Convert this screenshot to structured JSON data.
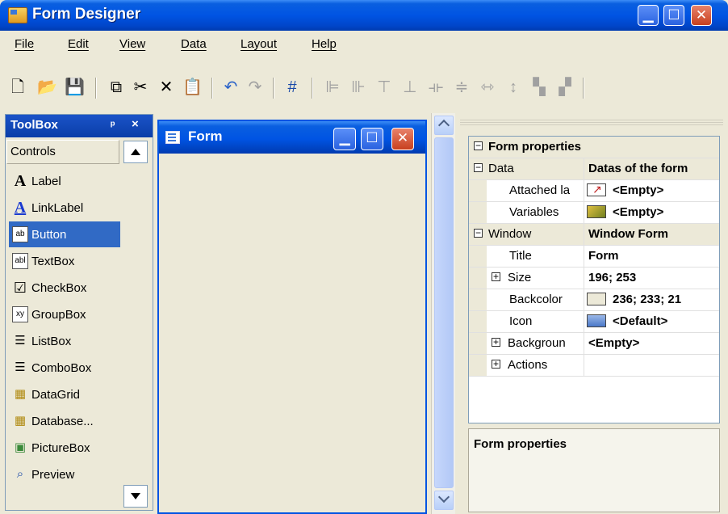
{
  "window": {
    "title": "Form Designer"
  },
  "menu": [
    "File",
    "Edit",
    "View",
    "Data",
    "Layout",
    "Help"
  ],
  "toolbox": {
    "title": "ToolBox",
    "pin": "ᵖ",
    "close": "×",
    "category": "Controls",
    "items": [
      {
        "label": "Label",
        "icon": "A"
      },
      {
        "label": "LinkLabel",
        "icon": "A"
      },
      {
        "label": "Button",
        "icon": "ab"
      },
      {
        "label": "TextBox",
        "icon": "abl"
      },
      {
        "label": "CheckBox",
        "icon": "☑"
      },
      {
        "label": "GroupBox",
        "icon": "xy"
      },
      {
        "label": "ListBox",
        "icon": "☰"
      },
      {
        "label": "ComboBox",
        "icon": "☰"
      },
      {
        "label": "DataGrid",
        "icon": "▦"
      },
      {
        "label": "Database...",
        "icon": "▦"
      },
      {
        "label": "PictureBox",
        "icon": "▣"
      },
      {
        "label": "Preview",
        "icon": "⌕"
      }
    ],
    "selected_index": 2
  },
  "form_window": {
    "title": "Form"
  },
  "properties": {
    "rows": [
      {
        "name": "Form properties",
        "value": "",
        "kind": "header",
        "expander": "−"
      },
      {
        "name": "Data",
        "value": "Datas of the form",
        "kind": "cat",
        "expander": "−"
      },
      {
        "name": "Attached la",
        "value": "<Empty>",
        "kind": "child",
        "swatch": "link"
      },
      {
        "name": "Variables",
        "value": "<Empty>",
        "kind": "child",
        "swatch": "var"
      },
      {
        "name": "Window",
        "value": "Window Form",
        "kind": "cat",
        "expander": "−"
      },
      {
        "name": "Title",
        "value": "Form",
        "kind": "child"
      },
      {
        "name": "Size",
        "value": "196; 253",
        "kind": "childexp",
        "expander": "+"
      },
      {
        "name": "Backcolor",
        "value": "236; 233; 21",
        "kind": "child",
        "swatch": "color"
      },
      {
        "name": "Icon",
        "value": "<Default>",
        "kind": "child",
        "swatch": "icon"
      },
      {
        "name": "Backgroun",
        "value": "<Empty>",
        "kind": "childexp",
        "expander": "+"
      },
      {
        "name": "Actions",
        "value": "",
        "kind": "childexp",
        "expander": "+"
      }
    ],
    "description_title": "Form properties"
  },
  "colors": {
    "accent": "#0054e3",
    "selection": "#316ac5",
    "backcolor_swatch": "#ece9d8"
  }
}
